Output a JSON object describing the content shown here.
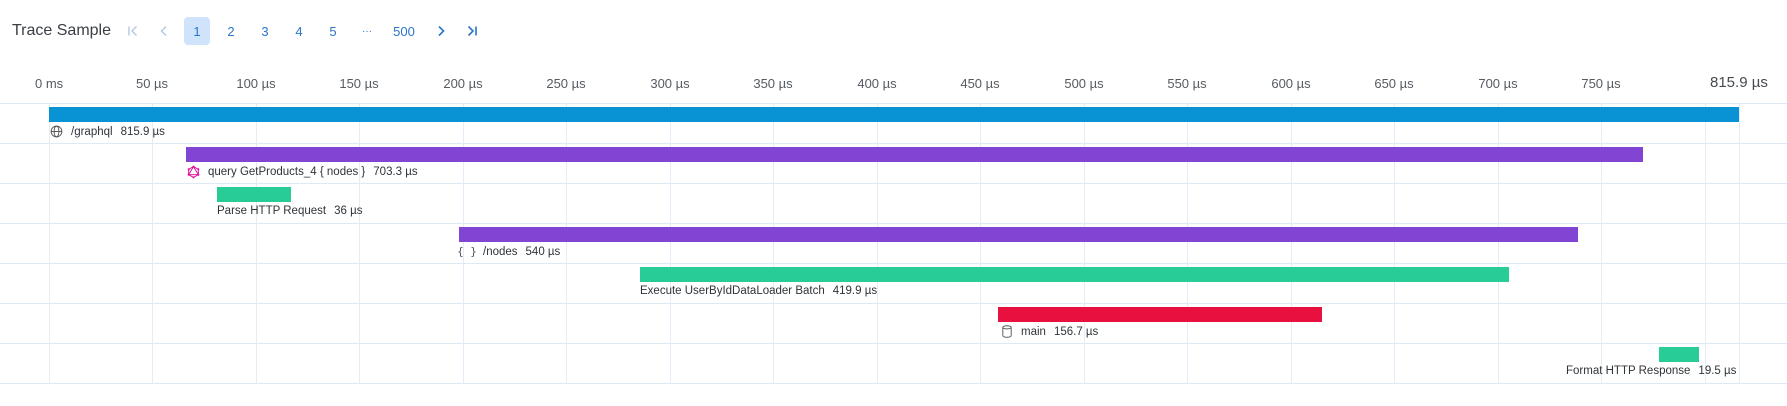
{
  "header": {
    "title": "Trace Sample"
  },
  "pagination": {
    "first_icon": "first-page-icon",
    "prev_icon": "chevron-left-icon",
    "pages": [
      "1",
      "2",
      "3",
      "4",
      "5",
      "···",
      "500"
    ],
    "current": "1",
    "next_icon": "chevron-right-icon",
    "last_icon": "last-page-icon"
  },
  "axis": {
    "ticks": [
      "0 ms",
      "50 µs",
      "100 µs",
      "150 µs",
      "200 µs",
      "250 µs",
      "300 µs",
      "350 µs",
      "400 µs",
      "450 µs",
      "500 µs",
      "550 µs",
      "600 µs",
      "650 µs",
      "700 µs",
      "750 µs",
      "815.9 µs"
    ]
  },
  "colors": {
    "http": "#0a93d4",
    "graphql": "#8245d3",
    "process": "#27cc96",
    "db": "#e8103f",
    "grid": "#e4edf7"
  },
  "spans": [
    {
      "name": "/graphql",
      "duration": "815.9 µs",
      "icon": "globe-icon",
      "color": "#0a93d4"
    },
    {
      "name": "query GetProducts_4 { nodes }",
      "duration": "703.3 µs",
      "icon": "graphql-icon",
      "color": "#8245d3"
    },
    {
      "name": "Parse HTTP Request",
      "duration": "36 µs",
      "icon": "",
      "color": "#27cc96"
    },
    {
      "name": "/nodes",
      "duration": "540 µs",
      "icon": "braces-icon",
      "color": "#8245d3"
    },
    {
      "name": "Execute UserByIdDataLoader Batch",
      "duration": "419.9 µs",
      "icon": "",
      "color": "#27cc96"
    },
    {
      "name": "main",
      "duration": "156.7 µs",
      "icon": "database-icon",
      "color": "#e8103f"
    },
    {
      "name": "Format HTTP Response",
      "duration": "19.5 µs",
      "icon": "",
      "color": "#27cc96"
    }
  ]
}
